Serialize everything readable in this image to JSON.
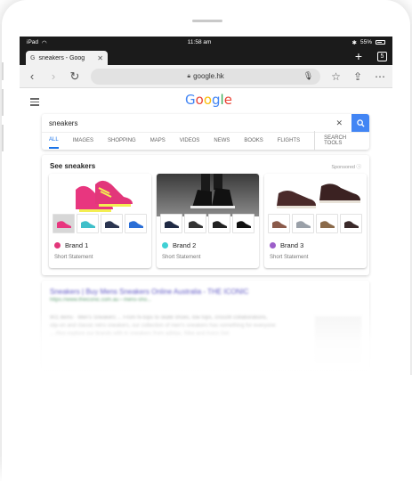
{
  "status_bar": {
    "device": "iPad",
    "time": "11:58 am",
    "battery": "55%"
  },
  "tab": {
    "title": "sneakers - Goog",
    "count": "5"
  },
  "address_bar": {
    "url": "google.hk"
  },
  "google": {
    "query": "sneakers",
    "filters": [
      "ALL",
      "IMAGES",
      "SHOPPING",
      "MAPS",
      "VIDEOS",
      "NEWS",
      "BOOKS",
      "FLIGHTS"
    ],
    "search_tools": "SEARCH TOOLS"
  },
  "shopping": {
    "title": "See sneakers",
    "sponsored": "Sponsored",
    "products": [
      {
        "brand": "Brand 1",
        "statement": "Short Statement",
        "dot_color": "#e2367a"
      },
      {
        "brand": "Brand 2",
        "statement": "Short Statement",
        "dot_color": "#3fd0d4"
      },
      {
        "brand": "Brand 3",
        "statement": "Short Statement",
        "dot_color": "#9c5ec9"
      }
    ]
  },
  "result": {
    "title": "Sneakers | Buy Mens Sneakers Online Australia - THE ICONIC",
    "url": "https://www.theiconic.com.au › mens-sho...",
    "snippet": "901 items · Men's Sneakers ... From hi-tops to skate shoes, low tops, crossfit collaborations, slip-on and classic retro sneakers, our collection of men's sneakers has something for everyone ... Also explore our brands with in sneakers from adidas, Nike and Asics Gel."
  },
  "colors": {
    "accent": "#4285f4",
    "status_bar": "#1b1b1b"
  }
}
